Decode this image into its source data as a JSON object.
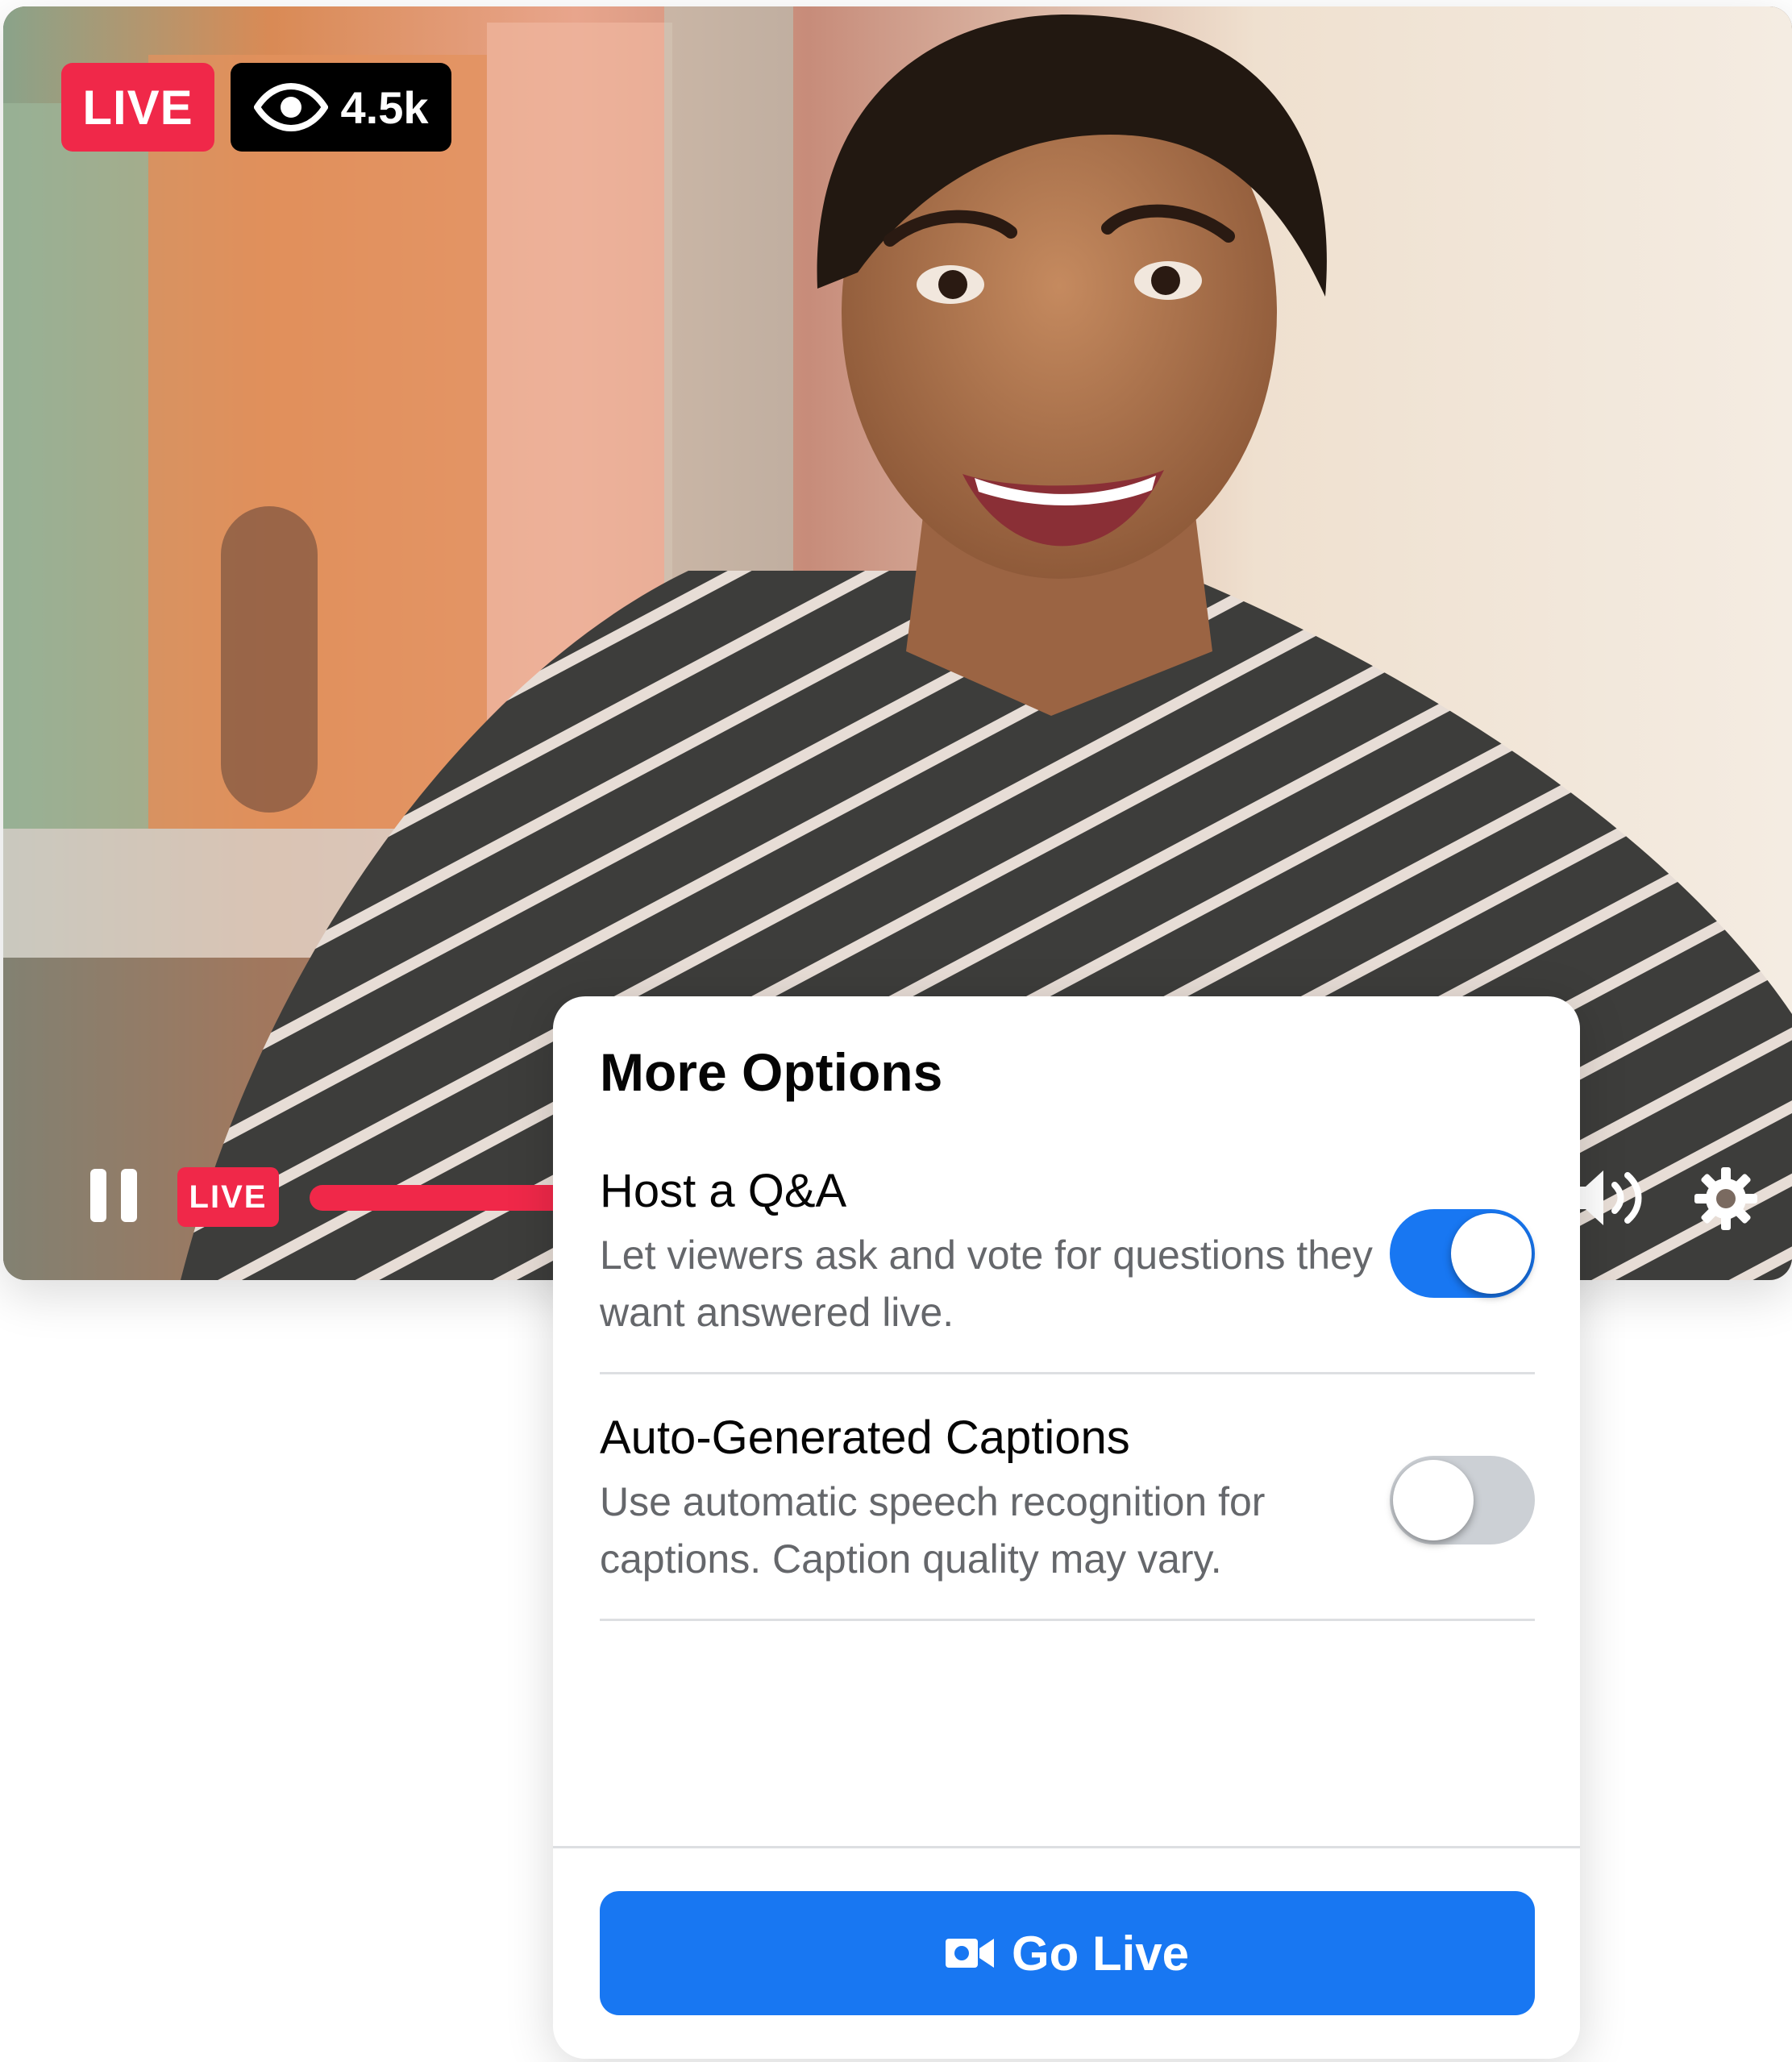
{
  "video": {
    "live_badge": "LIVE",
    "viewer_count": "4.5k",
    "controls": {
      "live_label": "LIVE"
    }
  },
  "panel": {
    "title": "More Options",
    "options": [
      {
        "title": "Host a Q&A",
        "description": "Let viewers ask and vote for questions they want answered live.",
        "enabled": true
      },
      {
        "title": "Auto-Generated Captions",
        "description": "Use automatic speech recognition for captions. Caption quality may vary.",
        "enabled": false
      }
    ],
    "go_live_label": "Go Live"
  },
  "colors": {
    "live_red": "#f02849",
    "facebook_blue": "#1877f2",
    "toggle_off": "#ccd0d5",
    "secondary_text": "#65676b"
  }
}
